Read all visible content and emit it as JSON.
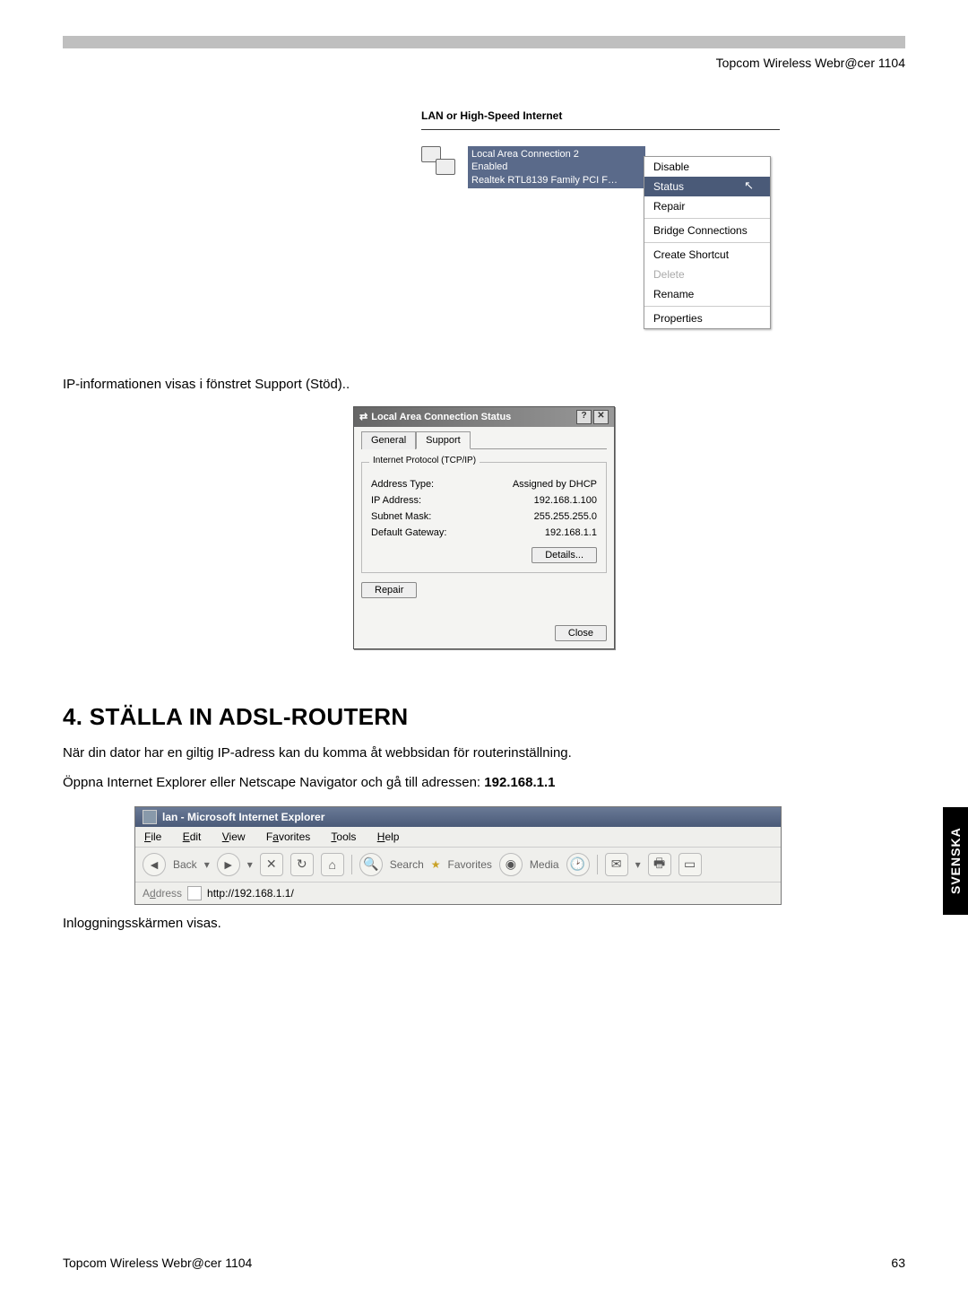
{
  "header_right": "Topcom Wireless Webr@cer 1104",
  "side_tab": "SVENSKA",
  "shot1": {
    "section_title": "LAN or High-Speed Internet",
    "conn_name": "Local Area Connection 2",
    "conn_state": "Enabled",
    "conn_adapter": "Realtek RTL8139 Family PCI F…",
    "menu": {
      "disable": "Disable",
      "status": "Status",
      "repair": "Repair",
      "bridge": "Bridge Connections",
      "shortcut": "Create Shortcut",
      "delete": "Delete",
      "rename": "Rename",
      "properties": "Properties"
    }
  },
  "text_after_shot1": "IP-informationen visas i fönstret Support (Stöd)..",
  "dialog": {
    "title": "Local Area Connection Status",
    "tab_general": "General",
    "tab_support": "Support",
    "group_title": "Internet Protocol (TCP/IP)",
    "rows": {
      "addr_type_label": "Address Type:",
      "addr_type_value": "Assigned by DHCP",
      "ip_label": "IP Address:",
      "ip_value": "192.168.1.100",
      "mask_label": "Subnet Mask:",
      "mask_value": "255.255.255.0",
      "gw_label": "Default Gateway:",
      "gw_value": "192.168.1.1"
    },
    "btn_details": "Details...",
    "btn_repair": "Repair",
    "btn_close": "Close"
  },
  "section_heading": "4. STÄLLA IN ADSL-ROUTERN",
  "para1": "När din dator har en giltig IP-adress kan du komma åt webbsidan för routerinställning.",
  "para2_a": "Öppna Internet Explorer eller Netscape Navigator och gå till adressen: ",
  "para2_b": "192.168.1.1",
  "ie": {
    "title": "lan - Microsoft Internet Explorer",
    "menu": {
      "file": "File",
      "edit": "Edit",
      "view": "View",
      "fav": "Favorites",
      "tools": "Tools",
      "help": "Help"
    },
    "tool": {
      "back": "Back",
      "search": "Search",
      "favorites": "Favorites",
      "media": "Media"
    },
    "addr_label": "Address",
    "addr_value": "http://192.168.1.1/"
  },
  "text_after_ie": "Inloggningsskärmen visas.",
  "footer_left": "Topcom Wireless Webr@cer 1104",
  "footer_right": "63"
}
